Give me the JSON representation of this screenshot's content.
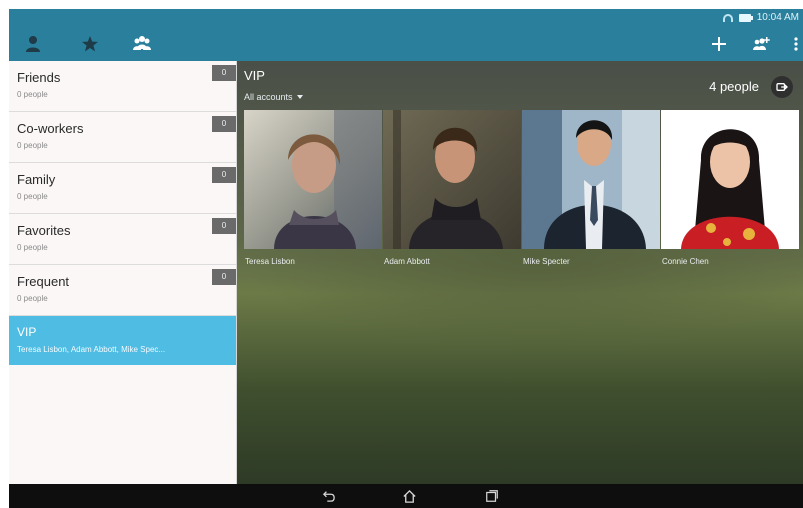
{
  "status_bar": {
    "time": "10:04 AM"
  },
  "tabs": [
    {
      "name": "contacts-tab",
      "icon": "person-icon"
    },
    {
      "name": "favorites-tab",
      "icon": "star-icon"
    },
    {
      "name": "groups-tab",
      "icon": "groups-icon"
    }
  ],
  "actions": [
    {
      "name": "add-group-button",
      "icon": "plus-icon"
    },
    {
      "name": "add-members-button",
      "icon": "add-people-icon"
    },
    {
      "name": "more-options-button",
      "icon": "overflow-icon"
    }
  ],
  "groups": [
    {
      "label": "Friends",
      "subtitle": "0 people",
      "count": "0"
    },
    {
      "label": "Co-workers",
      "subtitle": "0 people",
      "count": "0"
    },
    {
      "label": "Family",
      "subtitle": "0 people",
      "count": "0"
    },
    {
      "label": "Favorites",
      "subtitle": "0 people",
      "count": "0"
    },
    {
      "label": "Frequent",
      "subtitle": "0 people",
      "count": "0"
    },
    {
      "label": "VIP",
      "subtitle": "Teresa Lisbon, Adam Abbott, Mike Spec..."
    }
  ],
  "main": {
    "title": "VIP",
    "accounts_filter": "All accounts",
    "people_count": "4 people",
    "contacts": [
      {
        "name": "Teresa Lisbon"
      },
      {
        "name": "Adam Abbott"
      },
      {
        "name": "Mike Specter"
      },
      {
        "name": "Connie Chen"
      }
    ]
  },
  "colors": {
    "action_bar": "#2a7f9c",
    "selected_item": "#4fbce3"
  }
}
